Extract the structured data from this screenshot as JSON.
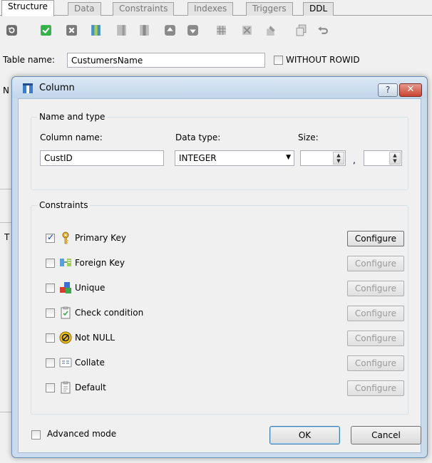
{
  "tabs": [
    "Structure",
    "Data",
    "Constraints",
    "Indexes",
    "Triggers",
    "DDL"
  ],
  "toolbar_icons": [
    "refresh-icon",
    "commit-icon",
    "rollback-icon",
    "add-column-icon",
    "add-column-disabled-icon",
    "delete-column-icon",
    "move-up-icon",
    "move-down-icon",
    "table-constraint-icon",
    "table-constraint-alt-icon",
    "edit-icon",
    "copy-icon",
    "undo-icon"
  ],
  "table": {
    "name_label": "Table name:",
    "name_value": "CustumersName",
    "without_rowid_label": "WITHOUT ROWID",
    "bg_fragments": [
      "N",
      "T"
    ]
  },
  "dialog": {
    "title": "Column",
    "help_label": "?",
    "close_label": "✕",
    "name_and_type": {
      "group_title": "Name and type",
      "column_name_label": "Column name:",
      "column_name_value": "CustID",
      "data_type_label": "Data type:",
      "data_type_value": "INTEGER",
      "size_label": "Size:",
      "size_separator": ","
    },
    "constraints": {
      "group_title": "Constraints",
      "items": [
        {
          "label": "Primary Key",
          "checked": true,
          "icon": "primary-key-icon",
          "configure": "Configure",
          "configure_enabled": true
        },
        {
          "label": "Foreign Key",
          "checked": false,
          "icon": "foreign-key-icon",
          "configure": "Configure",
          "configure_enabled": false
        },
        {
          "label": "Unique",
          "checked": false,
          "icon": "unique-icon",
          "configure": "Configure",
          "configure_enabled": false
        },
        {
          "label": "Check condition",
          "checked": false,
          "icon": "check-condition-icon",
          "configure": "Configure",
          "configure_enabled": false
        },
        {
          "label": "Not NULL",
          "checked": false,
          "icon": "not-null-icon",
          "configure": "Configure",
          "configure_enabled": false
        },
        {
          "label": "Collate",
          "checked": false,
          "icon": "collate-icon",
          "configure": "Configure",
          "configure_enabled": false
        },
        {
          "label": "Default",
          "checked": false,
          "icon": "default-icon",
          "configure": "Configure",
          "configure_enabled": false
        }
      ]
    },
    "advanced_mode_label": "Advanced mode",
    "ok_label": "OK",
    "cancel_label": "Cancel"
  }
}
